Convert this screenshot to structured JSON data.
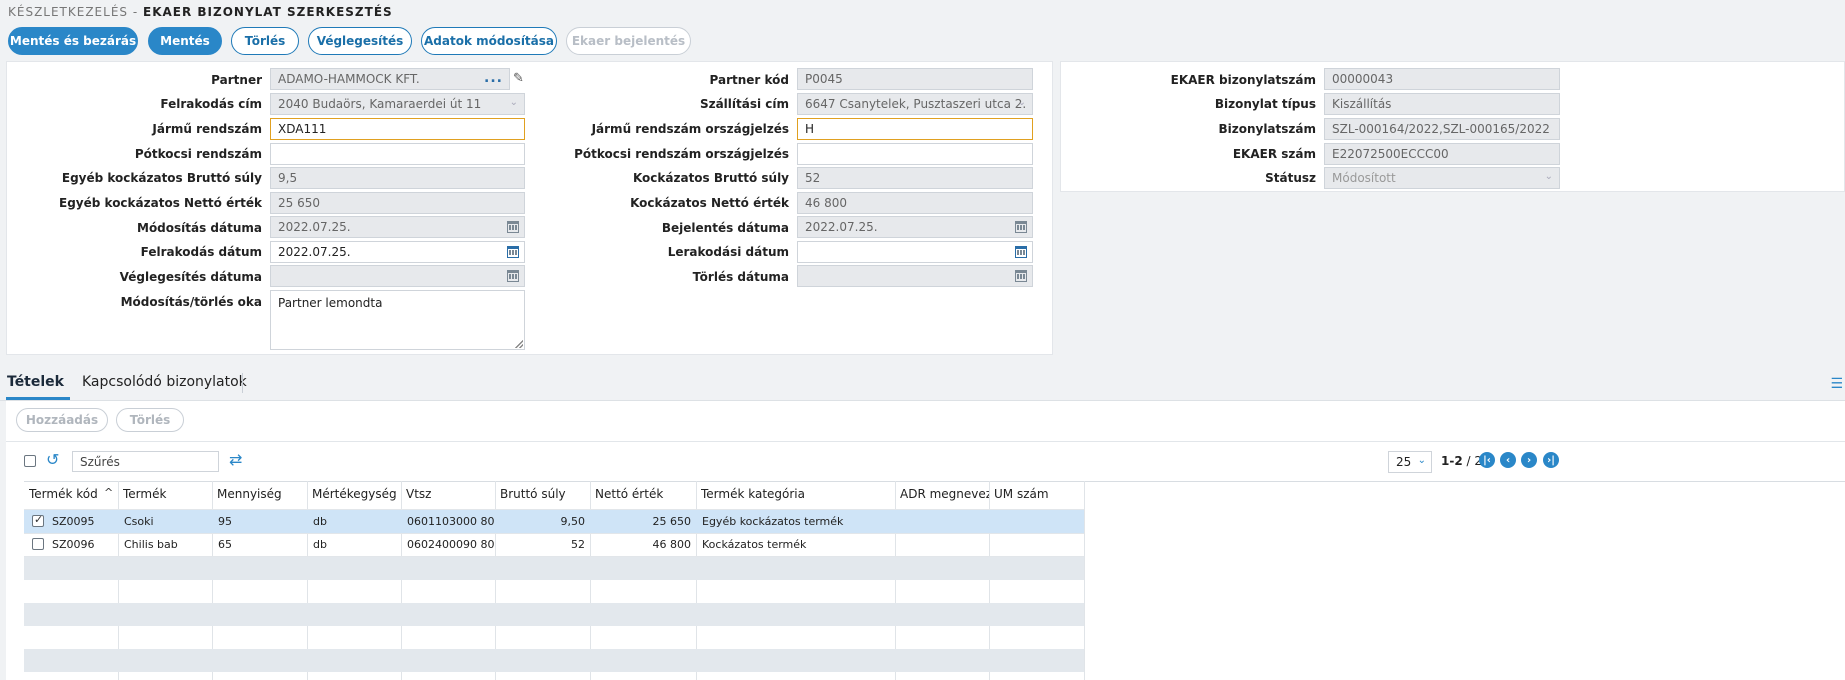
{
  "breadcrumb": {
    "parent": "KÉSZLETKEZELÉS -",
    "title": "EKAER BIZONYLAT SZERKESZTÉS"
  },
  "toolbar": {
    "save_close": "Mentés és bezárás",
    "save": "Mentés",
    "delete": "Törlés",
    "finalize": "Véglegesítés",
    "modify": "Adatok módosítása",
    "report": "Ekaer bejelentés"
  },
  "form_left": {
    "partner": {
      "label": "Partner",
      "value": "ADAMO-HAMMOCK KFT."
    },
    "loading_address": {
      "label": "Felrakodás cím",
      "value": "2040 Budaörs, Kamaraerdei út 11"
    },
    "vehicle_plate": {
      "label": "Jármű rendszám",
      "value": "XDA111"
    },
    "trailer_plate": {
      "label": "Pótkocsi rendszám",
      "value": ""
    },
    "other_gross_weight": {
      "label": "Egyéb kockázatos Bruttó súly",
      "value": "9,5"
    },
    "other_net_value": {
      "label": "Egyéb kockázatos Nettó érték",
      "value": "25 650"
    },
    "modified_date": {
      "label": "Módosítás dátuma",
      "value": "2022.07.25."
    },
    "loading_date": {
      "label": "Felrakodás dátum",
      "value": "2022.07.25."
    },
    "finalized_date": {
      "label": "Véglegesítés dátuma",
      "value": ""
    },
    "reason": {
      "label": "Módosítás/törlés oka",
      "value": "Partner lemondta"
    }
  },
  "form_middle": {
    "partner_code": {
      "label": "Partner kód",
      "value": "P0045"
    },
    "delivery_address": {
      "label": "Szállítási cím",
      "value": "6647 Csanytelek, Pusztaszeri utca 2."
    },
    "vehicle_country": {
      "label": "Jármű rendszám országjelzés",
      "value": "H"
    },
    "trailer_country": {
      "label": "Pótkocsi rendszám országjelzés",
      "value": ""
    },
    "gross_weight": {
      "label": "Kockázatos Bruttó súly",
      "value": "52"
    },
    "net_value": {
      "label": "Kockázatos Nettó érték",
      "value": "46 800"
    },
    "report_date": {
      "label": "Bejelentés dátuma",
      "value": "2022.07.25."
    },
    "unloading_date": {
      "label": "Lerakodási dátum",
      "value": ""
    },
    "deletion_date": {
      "label": "Törlés dátuma",
      "value": ""
    }
  },
  "form_right": {
    "ekaer_doc_number": {
      "label": "EKAER bizonylatszám",
      "value": "00000043"
    },
    "doc_type": {
      "label": "Bizonylat típus",
      "value": "Kiszállítás"
    },
    "doc_number": {
      "label": "Bizonylatszám",
      "value": "SZL-000164/2022,SZL-000165/2022"
    },
    "ekaer_number": {
      "label": "EKAER szám",
      "value": "E22072500ECCC00"
    },
    "status": {
      "label": "Státusz",
      "value": "Módosított"
    }
  },
  "tabs": {
    "items": "Tételek",
    "related": "Kapcsolódó bizonylatok"
  },
  "grid_toolbar": {
    "add": "Hozzáadás",
    "delete": "Törlés",
    "filter_placeholder": "Szűrés",
    "page_size": "25",
    "range": "1-2",
    "total": "/ 2"
  },
  "grid": {
    "columns": [
      "Termék kód",
      "Termék",
      "Mennyiség",
      "Mértékegység",
      "Vtsz",
      "Bruttó súly",
      "Nettó érték",
      "Termék kategória",
      "ADR megnevezés",
      "UM szám"
    ],
    "rows": [
      {
        "checked": true,
        "code": "SZ0095",
        "product": "Csoki",
        "qty": "95",
        "unit": "db",
        "vtsz": "0601103000 80",
        "gross": "9,50",
        "net": "25 650",
        "category": "Egyéb kockázatos termék",
        "adr": "",
        "um": ""
      },
      {
        "checked": false,
        "code": "SZ0096",
        "product": "Chilis bab",
        "qty": "65",
        "unit": "db",
        "vtsz": "0602400090 80",
        "gross": "52",
        "net": "46 800",
        "category": "Kockázatos termék",
        "adr": "",
        "um": ""
      }
    ]
  },
  "colors": {
    "accent": "#2a87c8",
    "selected_row": "#cfe4f7",
    "focus_border": "#e0a020"
  }
}
